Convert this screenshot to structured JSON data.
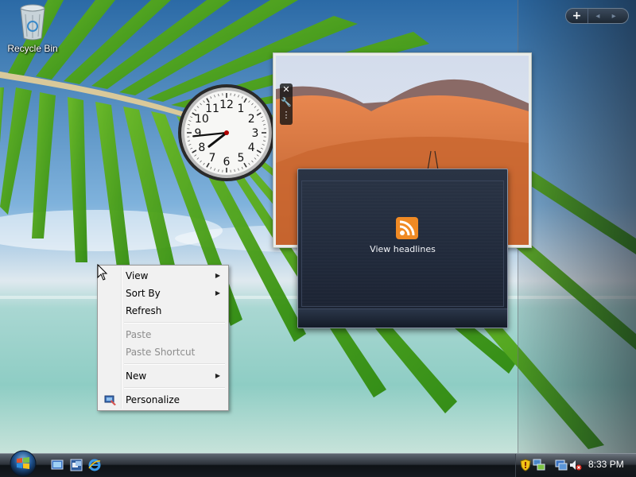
{
  "desktop": {
    "recycle_bin_label": "Recycle Bin"
  },
  "sidebar": {
    "add_symbol": "+",
    "nav_symbols": "◂ ▸"
  },
  "clock_gadget": {
    "hour": 7,
    "minute": 44,
    "numbers": [
      "12",
      "1",
      "2",
      "3",
      "4",
      "5",
      "6",
      "7",
      "8",
      "9",
      "10",
      "11"
    ]
  },
  "gadget_tools": {
    "close": "✕",
    "options": "🔧",
    "drag": "⋮"
  },
  "feed_gadget": {
    "label": "View headlines",
    "icon": "rss-icon"
  },
  "context_menu": {
    "items": [
      {
        "label": "View",
        "submenu": true,
        "enabled": true
      },
      {
        "label": "Sort By",
        "submenu": true,
        "enabled": true
      },
      {
        "label": "Refresh",
        "submenu": false,
        "enabled": true
      },
      {
        "label": "Paste",
        "submenu": false,
        "enabled": false
      },
      {
        "label": "Paste Shortcut",
        "submenu": false,
        "enabled": false
      },
      {
        "label": "New",
        "submenu": true,
        "enabled": true
      },
      {
        "label": "Personalize",
        "submenu": false,
        "enabled": true,
        "icon": "personalize-icon"
      }
    ]
  },
  "taskbar": {
    "start_icon": "windows-orb-icon",
    "quick_launch": [
      "show-desktop-icon",
      "switch-windows-icon",
      "internet-explorer-icon"
    ],
    "tray_icons": [
      "security-shield-icon",
      "network-icon",
      "display-icon",
      "volume-muted-icon"
    ],
    "time": "8:33 PM"
  },
  "colors": {
    "taskbar": "#161b21",
    "feed_background": "#20293a",
    "menu_background": "#f1f1f1",
    "rss_orange": "#f08a24"
  }
}
